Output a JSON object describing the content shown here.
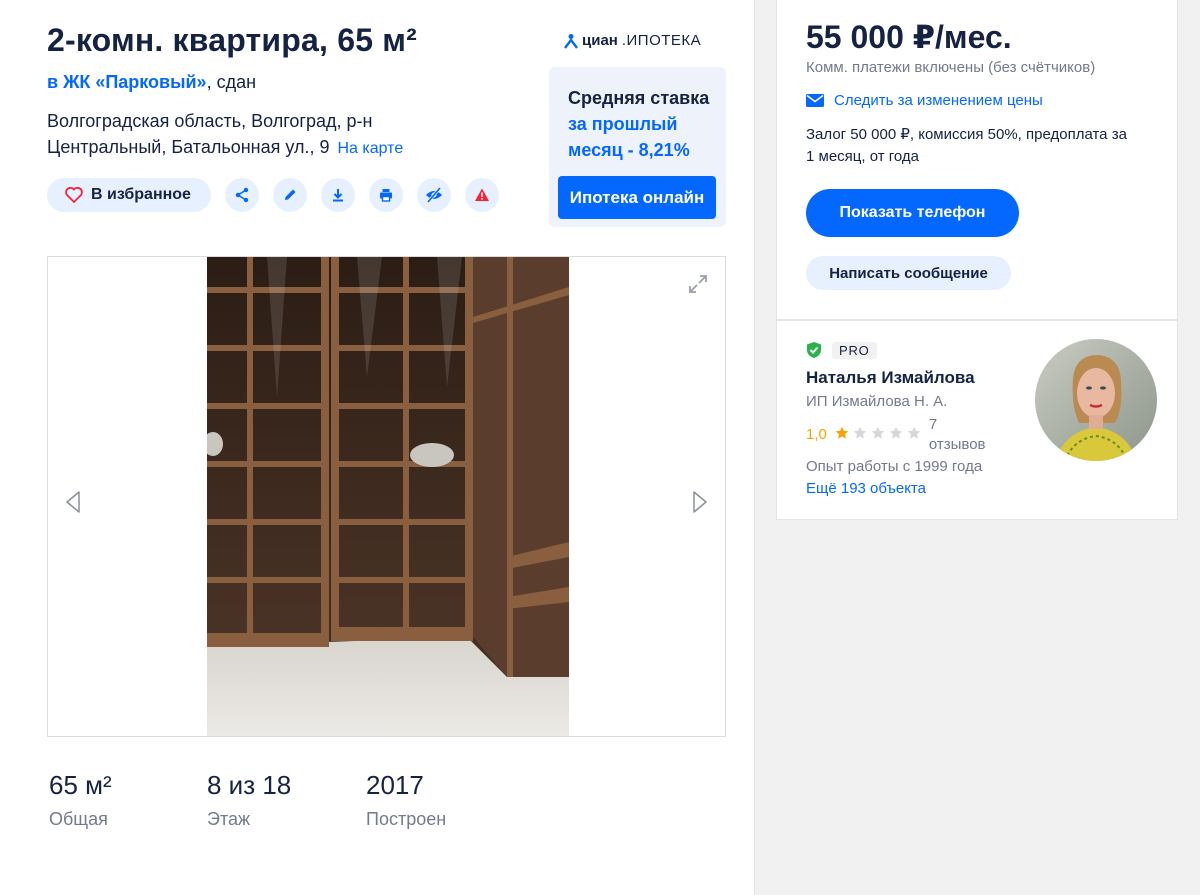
{
  "listing": {
    "title": "2-комн. квартира, 65 м²",
    "complex_link": "в ЖК «Парковый»",
    "complex_status": ", сдан",
    "address": "Волгоградская область, Волгоград, р-н Центральный, Батальонная ул., 9",
    "map_link": "На карте"
  },
  "actions": {
    "favorite_label": "В избранное",
    "icons": [
      "heart-icon",
      "share-icon",
      "edit-icon",
      "download-icon",
      "print-icon",
      "hide-icon",
      "report-icon"
    ]
  },
  "mortgage_ad": {
    "logo_brand": "циан",
    "logo_sub": ".ИПОТЕКА",
    "text_line1": "Средняя ставка",
    "text_blue": "за прошлый месяц - 8,21%",
    "button": "Ипотека онлайн"
  },
  "params": [
    {
      "value": "65 м²",
      "label": "Общая"
    },
    {
      "value": "8 из 18",
      "label": "Этаж"
    },
    {
      "value": "2017",
      "label": "Построен"
    }
  ],
  "offer": {
    "price": "55 000 ₽/мес.",
    "utilities": "Комм. платежи включены (без счётчиков)",
    "follow_price": "Следить за изменением цены",
    "terms": "Залог 50 000 ₽, комиссия 50%, предоплата за 1 месяц, от года",
    "show_phone": "Показать телефон",
    "write_message": "Написать сообщение"
  },
  "agent": {
    "pro_badge": "PRO",
    "name": "Наталья Измайлова",
    "company": "ИП Измайлова Н. А.",
    "rating": "1,0",
    "stars_filled": 1,
    "stars_total": 5,
    "reviews_count": "7",
    "reviews_label": "отзывов",
    "experience": "Опыт работы с 1999 года",
    "more_objects": "Ещё 193 объекта"
  },
  "colors": {
    "accent": "#0468ff",
    "text": "#152242",
    "muted": "#737a8e",
    "star": "#f8a300",
    "verified": "#2bb34a"
  }
}
